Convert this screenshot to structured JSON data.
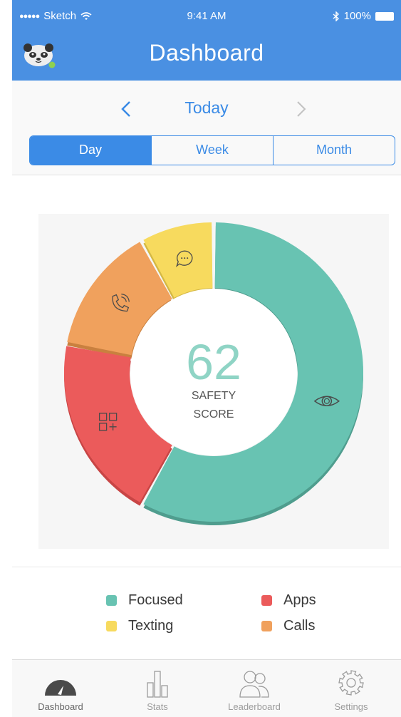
{
  "status": {
    "carrier": "Sketch",
    "time": "9:41 AM",
    "battery": "100%"
  },
  "header": {
    "title": "Dashboard"
  },
  "date_nav": {
    "label": "Today"
  },
  "segments": [
    {
      "label": "Day",
      "active": true
    },
    {
      "label": "Week",
      "active": false
    },
    {
      "label": "Month",
      "active": false
    }
  ],
  "score": {
    "value": "62",
    "line1": "SAFETY",
    "line2": "SCORE"
  },
  "chart_data": {
    "type": "pie",
    "variant": "donut",
    "center_value": 62,
    "series": [
      {
        "name": "Focused",
        "value": 58,
        "color": "#68c3b2",
        "icon": "eye-icon"
      },
      {
        "name": "Apps",
        "value": 20,
        "color": "#eb5b5b",
        "icon": "apps-grid-icon"
      },
      {
        "name": "Calls",
        "value": 14,
        "color": "#f0a15d",
        "icon": "phone-icon"
      },
      {
        "name": "Texting",
        "value": 8,
        "color": "#f7da5e",
        "icon": "chat-bubble-icon"
      }
    ]
  },
  "legend": {
    "focused": "Focused",
    "apps": "Apps",
    "texting": "Texting",
    "calls": "Calls"
  },
  "colors": {
    "header": "#4a90e2",
    "accent": "#3b8be6",
    "focused": "#68c3b2",
    "apps": "#eb5b5b",
    "calls": "#f0a15d",
    "texting": "#f7da5e"
  },
  "tabs": [
    {
      "label": "Dashboard",
      "icon": "speedometer-icon",
      "active": true
    },
    {
      "label": "Stats",
      "icon": "bar-chart-icon",
      "active": false
    },
    {
      "label": "Leaderboard",
      "icon": "people-icon",
      "active": false
    },
    {
      "label": "Settings",
      "icon": "gear-icon",
      "active": false
    }
  ]
}
